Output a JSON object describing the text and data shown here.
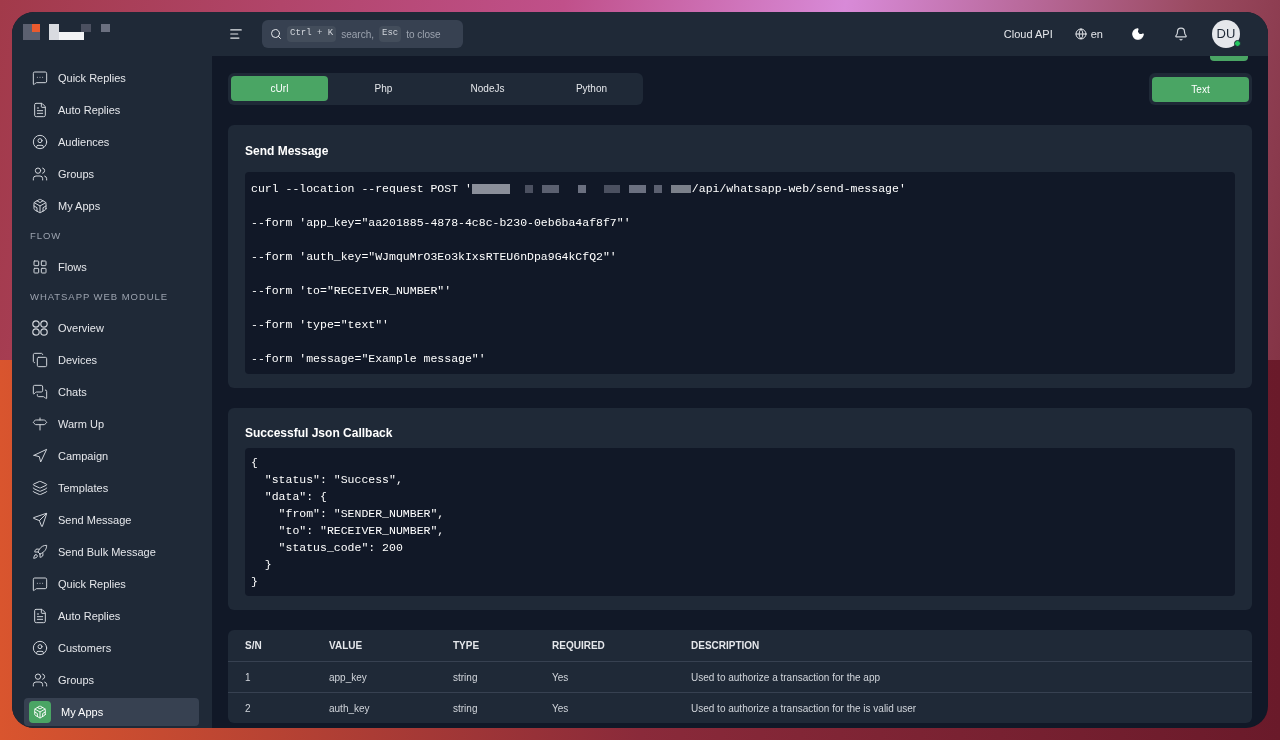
{
  "header": {
    "search": {
      "keys": [
        {
          "key": "Ctrl + K",
          "text": "search,"
        },
        {
          "key": "Esc",
          "text": "to close"
        }
      ]
    },
    "cloud_api": "Cloud API",
    "language": "en",
    "user": {
      "initials": "DU",
      "online": true
    }
  },
  "sidebar": [
    {
      "kind": "item",
      "label": "Quick Replies",
      "selected": false
    },
    {
      "kind": "item",
      "label": "Auto Replies",
      "selected": false
    },
    {
      "kind": "item",
      "label": "Audiences",
      "selected": false
    },
    {
      "kind": "item",
      "label": "Groups",
      "selected": false
    },
    {
      "kind": "item",
      "label": "My Apps",
      "selected": false
    },
    {
      "kind": "heading",
      "label": "FLOW"
    },
    {
      "kind": "item",
      "label": "Flows",
      "selected": false
    },
    {
      "kind": "heading",
      "label": "WHATSAPP WEB MODULE"
    },
    {
      "kind": "item",
      "label": "Overview",
      "selected": false
    },
    {
      "kind": "item",
      "label": "Devices",
      "selected": false
    },
    {
      "kind": "item",
      "label": "Chats",
      "selected": false
    },
    {
      "kind": "item",
      "label": "Warm Up",
      "selected": false
    },
    {
      "kind": "item",
      "label": "Campaign",
      "selected": false
    },
    {
      "kind": "item",
      "label": "Templates",
      "selected": false
    },
    {
      "kind": "item",
      "label": "Send Message",
      "selected": false
    },
    {
      "kind": "item",
      "label": "Send Bulk Message",
      "selected": false
    },
    {
      "kind": "item",
      "label": "Quick Replies",
      "selected": false
    },
    {
      "kind": "item",
      "label": "Auto Replies",
      "selected": false
    },
    {
      "kind": "item",
      "label": "Customers",
      "selected": false
    },
    {
      "kind": "item",
      "label": "Groups",
      "selected": false
    },
    {
      "kind": "item",
      "label": "My Apps",
      "selected": true
    }
  ],
  "tabs": [
    {
      "label": "cUrl",
      "selected": true
    },
    {
      "label": "Php",
      "selected": false
    },
    {
      "label": "NodeJs",
      "selected": false
    },
    {
      "label": "Python",
      "selected": false
    }
  ],
  "type_button": "Text",
  "send_message": {
    "title": "Send Message",
    "url_prefix": "curl --location --request POST '",
    "url_suffix": "/api/whatsapp-web/send-message'",
    "lines": [
      "--form 'app_key=\"aa201885-4878-4c8c-b230-0eb6ba4af8f7\"'",
      "--form 'auth_key=\"WJmquMrO3Eo3kIxsRTEU6nDpa9G4kCfQ2\"'",
      "--form 'to=\"RECEIVER_NUMBER\"'",
      "--form 'type=\"text\"'",
      "--form 'message=\"Example message\"'"
    ]
  },
  "callback": {
    "title": "Successful Json Callback",
    "lines": [
      "{",
      "  \"status\": \"Success\",",
      "  \"data\": {",
      "    \"from\": \"SENDER_NUMBER\",",
      "    \"to\": \"RECEIVER_NUMBER\",",
      "    \"status_code\": 200",
      "  }",
      "}"
    ]
  },
  "table": {
    "columns": [
      "S/N",
      "VALUE",
      "TYPE",
      "REQUIRED",
      "DESCRIPTION"
    ],
    "rows": [
      [
        "1",
        "app_key",
        "string",
        "Yes",
        "Used to authorize a transaction for the app"
      ],
      [
        "2",
        "auth_key",
        "string",
        "Yes",
        "Used to authorize a transaction for the is valid user"
      ]
    ]
  }
}
